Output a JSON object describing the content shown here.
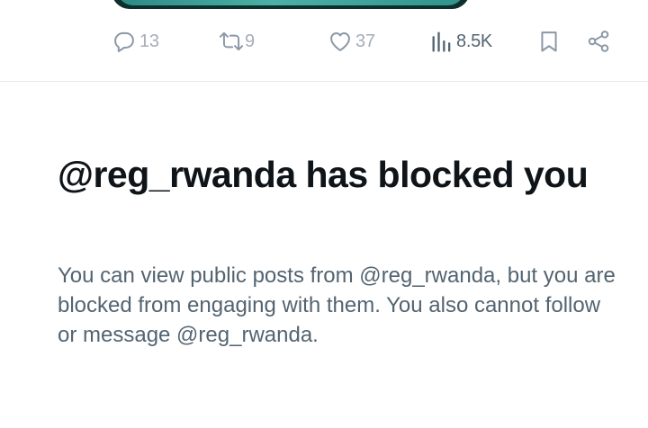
{
  "actions": {
    "replies": {
      "count": "13",
      "icon": "reply-icon"
    },
    "reposts": {
      "count": "9",
      "icon": "repost-icon"
    },
    "likes": {
      "count": "37",
      "icon": "heart-icon"
    },
    "views": {
      "count": "8.5K",
      "icon": "views-chart-icon"
    },
    "bookmark": {
      "icon": "bookmark-icon"
    },
    "share": {
      "icon": "share-icon"
    }
  },
  "blocked": {
    "title": "@reg_rwanda has blocked you",
    "body": "You can view public posts from @reg_rwanda, but you are blocked from engaging with them. You also cannot follow or message @reg_rwanda."
  },
  "colors": {
    "icon_gray": "#8b98a5",
    "count_gray": "#a3aeb8",
    "title": "#0f1419",
    "secondary_text": "#536471",
    "divider": "#e6e9ec",
    "media_teal": "#3aa399"
  }
}
